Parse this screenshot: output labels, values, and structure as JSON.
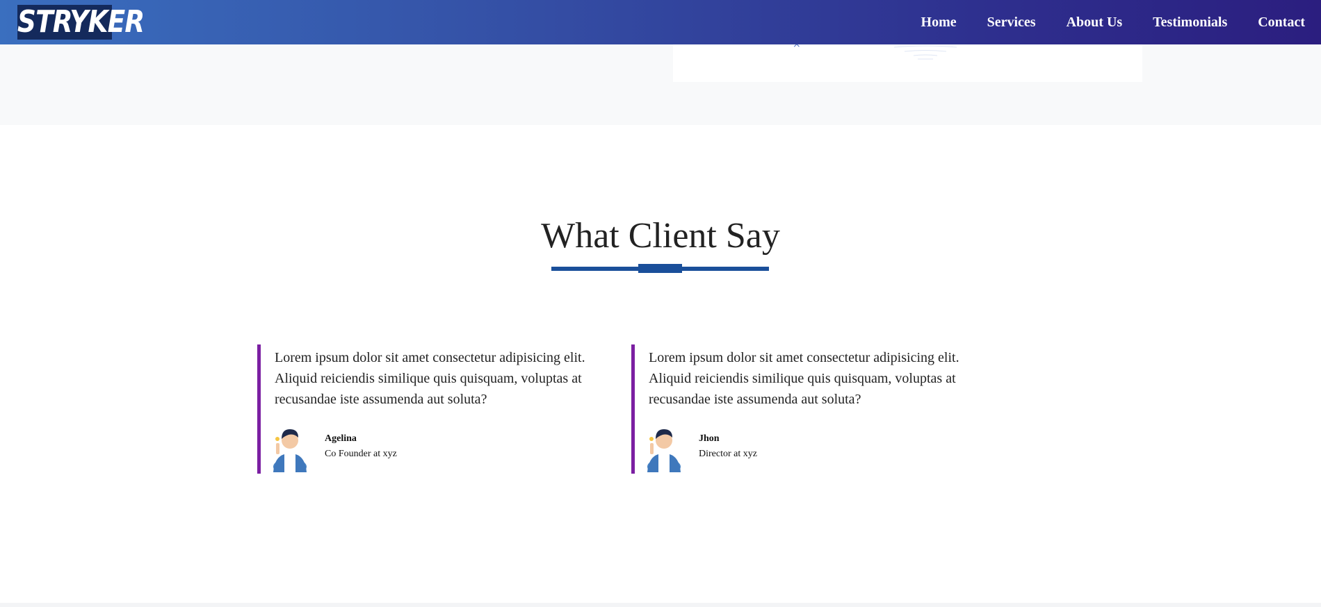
{
  "nav": {
    "logo_text": "STRYKER",
    "items": [
      {
        "label": "Home"
      },
      {
        "label": "Services"
      },
      {
        "label": "About Us"
      },
      {
        "label": "Testimonials"
      },
      {
        "label": "Contact"
      }
    ]
  },
  "partial_card": {
    "close_glyph": "×"
  },
  "testimonials": {
    "title": "What Client Say",
    "items": [
      {
        "quote": "Lorem ipsum dolor sit amet consectetur adipisicing elit. Aliquid reiciendis similique quis quisquam, voluptas at recusandae iste assumenda aut soluta?",
        "name": "Agelina",
        "role": "Co Founder at xyz",
        "avatar_icon": "person-avatar-icon"
      },
      {
        "quote": "Lorem ipsum dolor sit amet consectetur adipisicing elit. Aliquid reiciendis similique quis quisquam, voluptas at recusandae iste assumenda aut soluta?",
        "name": "Jhon",
        "role": "Director at xyz",
        "avatar_icon": "person-avatar-icon"
      }
    ]
  },
  "colors": {
    "nav_gradient_start": "#3a6fbf",
    "nav_gradient_end": "#2b1e7f",
    "accent_blue": "#1a4f9a",
    "card_border": "#7b1fa2"
  }
}
